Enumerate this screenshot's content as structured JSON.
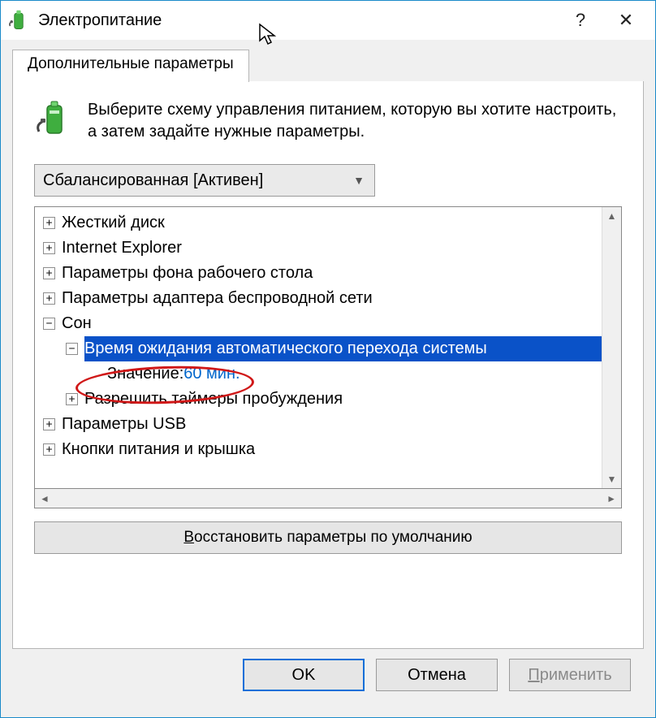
{
  "window": {
    "title": "Электропитание",
    "help_tooltip": "?",
    "close_tooltip": "✕"
  },
  "tab": {
    "label": "Дополнительные параметры"
  },
  "intro": {
    "text": "Выберите схему управления питанием, которую вы хотите настроить, а затем задайте нужные параметры."
  },
  "plan_select": {
    "value": "Сбалансированная [Активен]"
  },
  "tree": {
    "items": [
      {
        "expand": "+",
        "indent": 0,
        "label": "Жесткий диск"
      },
      {
        "expand": "+",
        "indent": 0,
        "label": "Internet Explorer"
      },
      {
        "expand": "+",
        "indent": 0,
        "label": "Параметры фона рабочего стола"
      },
      {
        "expand": "+",
        "indent": 0,
        "label": "Параметры адаптера беспроводной сети"
      },
      {
        "expand": "−",
        "indent": 0,
        "label": "Сон"
      },
      {
        "expand": "−",
        "indent": 1,
        "label": "Время ожидания автоматического перехода системы",
        "selected": true
      },
      {
        "expand": "",
        "indent": 2,
        "value_label": "Значение:",
        "value": "60 мин."
      },
      {
        "expand": "+",
        "indent": 1,
        "label": "Разрешить таймеры пробуждения"
      },
      {
        "expand": "+",
        "indent": 0,
        "label": "Параметры USB"
      },
      {
        "expand": "+",
        "indent": 0,
        "label": "Кнопки питания и крышка"
      }
    ]
  },
  "restore": {
    "prefix": "В",
    "rest": "осстановить параметры по умолчанию"
  },
  "footer": {
    "ok": "OK",
    "cancel": "Отмена",
    "apply_prefix": "П",
    "apply_rest": "рименить"
  }
}
